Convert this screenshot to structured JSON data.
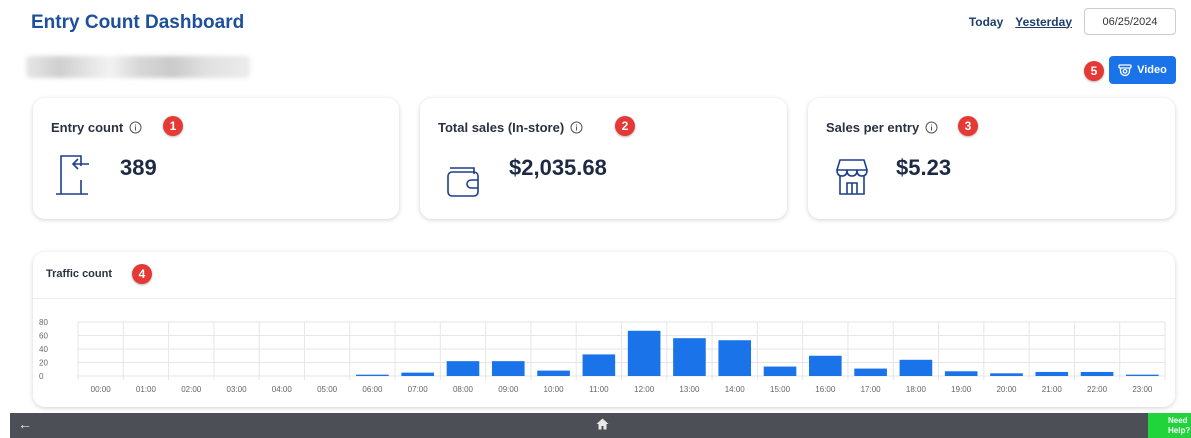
{
  "header": {
    "title": "Entry Count Dashboard",
    "today_label": "Today",
    "yesterday_label": "Yesterday",
    "date_value": "06/25/2024"
  },
  "annotations": [
    "1",
    "2",
    "3",
    "4",
    "5"
  ],
  "video_button": {
    "label": "Video",
    "icon": "camera-icon"
  },
  "cards": [
    {
      "label": "Entry count",
      "value": "389",
      "icon": "entry-door-icon"
    },
    {
      "label": "Total sales (In-store)",
      "value": "$2,035.68",
      "icon": "wallet-icon"
    },
    {
      "label": "Sales per entry",
      "value": "$5.23",
      "icon": "store-icon"
    }
  ],
  "traffic": {
    "label": "Traffic count"
  },
  "chart_data": {
    "type": "bar",
    "categories": [
      "00:00",
      "01:00",
      "02:00",
      "03:00",
      "04:00",
      "05:00",
      "06:00",
      "07:00",
      "08:00",
      "09:00",
      "10:00",
      "11:00",
      "12:00",
      "13:00",
      "14:00",
      "15:00",
      "16:00",
      "17:00",
      "18:00",
      "19:00",
      "20:00",
      "21:00",
      "22:00",
      "23:00"
    ],
    "values": [
      0,
      0,
      0,
      0,
      0,
      0,
      2,
      5,
      22,
      22,
      8,
      32,
      67,
      56,
      53,
      14,
      30,
      11,
      24,
      7,
      4,
      6,
      6,
      2
    ],
    "ylim": [
      0,
      80
    ],
    "yticks": [
      "0",
      "20",
      "40",
      "60",
      "80"
    ],
    "color": "#1a73e8",
    "grid": true
  },
  "footer": {
    "back_icon": "back-arrow-icon",
    "home_icon": "home-icon",
    "help_label": "Need Help?"
  },
  "colors": {
    "accent": "#1a73e8",
    "title": "#1c4f9c",
    "badge": "#e53935",
    "help": "#22d43c"
  }
}
